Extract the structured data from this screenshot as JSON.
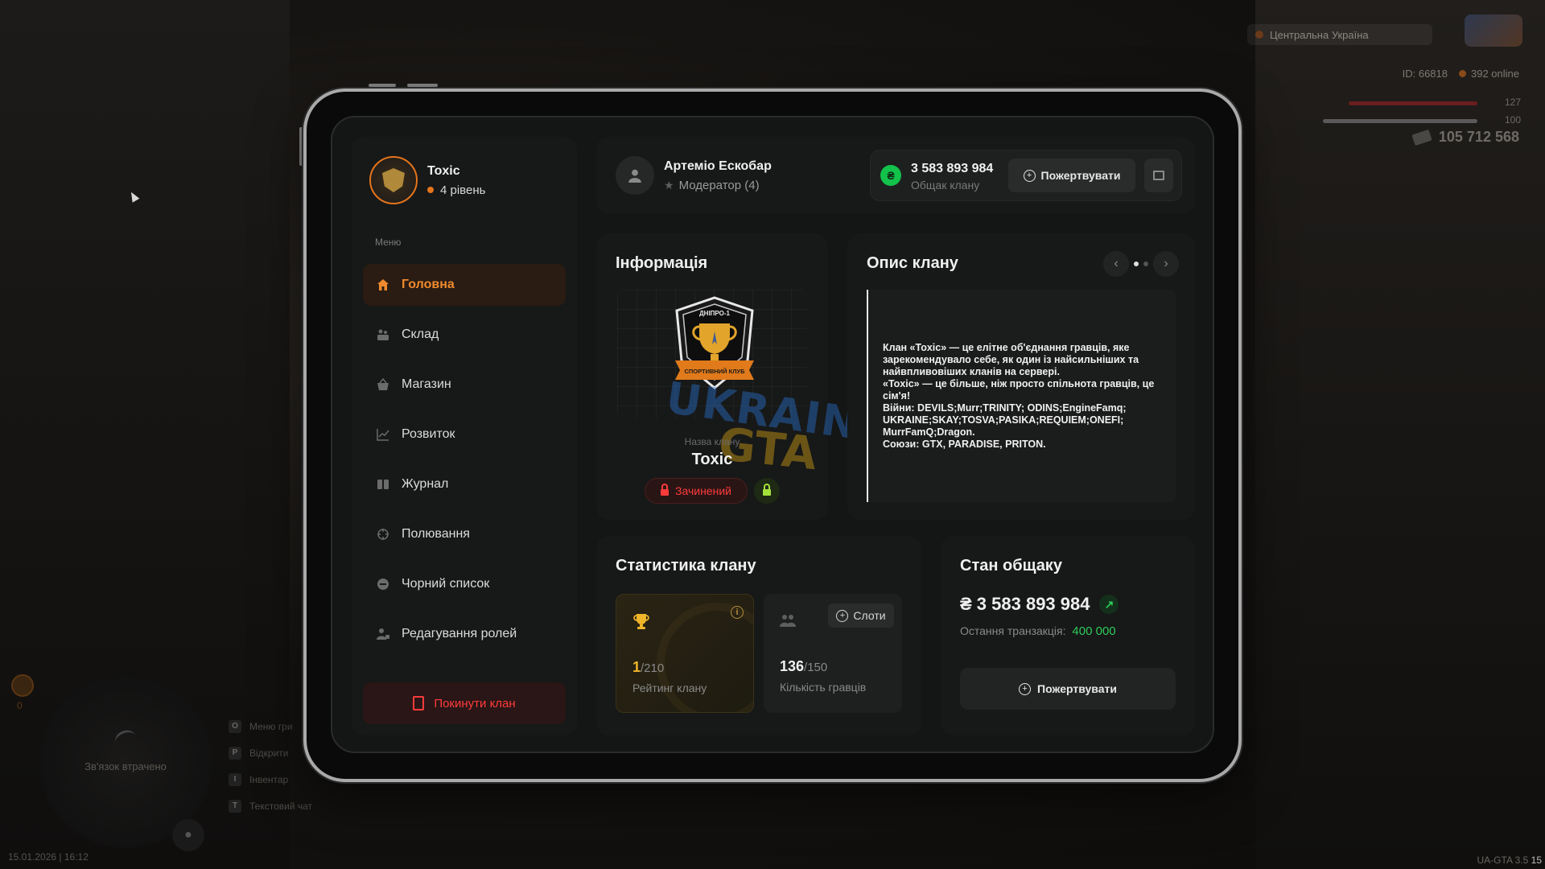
{
  "hud": {
    "region": "Центральна Україна",
    "player_id": "ID: 66818",
    "online": "392 online",
    "health": "127",
    "armor": "100",
    "money": "105 712 568",
    "minimap_status": "Зв'язок втрачено",
    "orange_counter": "0",
    "hints": [
      {
        "key": "O",
        "label": "Меню гри"
      },
      {
        "key": "P",
        "label": "Відкрити"
      },
      {
        "key": "I",
        "label": "Інвентар"
      },
      {
        "key": "T",
        "label": "Текстовий чат"
      }
    ],
    "datetime": "15.01.2026 | 16:12",
    "version": "UA-GTA 3.5",
    "version_suffix": "15"
  },
  "profile": {
    "clan_name": "Toxic",
    "level": "4 рівень"
  },
  "menu": {
    "caption": "Меню",
    "items": [
      {
        "label": "Головна",
        "icon": "home-icon",
        "active": true
      },
      {
        "label": "Склад",
        "icon": "warehouse-icon"
      },
      {
        "label": "Магазин",
        "icon": "basket-icon"
      },
      {
        "label": "Розвиток",
        "icon": "chart-icon"
      },
      {
        "label": "Журнал",
        "icon": "book-icon"
      },
      {
        "label": "Полювання",
        "icon": "crosshair-icon"
      },
      {
        "label": "Чорний список",
        "icon": "blocked-icon"
      },
      {
        "label": "Редагування ролей",
        "icon": "user-edit-icon"
      }
    ],
    "leave_label": "Покинути клан"
  },
  "user": {
    "name": "Артеміо Ескобар",
    "role": "Модератор (4)"
  },
  "wallet": {
    "currency_symbol": "₴",
    "amount": "3 583 893 984",
    "label": "Общак клану",
    "donate_label": "Пожертвувати"
  },
  "info": {
    "title": "Інформація",
    "emblem_top_text": "ДНІПРО-1",
    "emblem_ribbon_text": "СПОРТИВНИЙ КЛУБ",
    "watermark_line1": "UKRAINA",
    "watermark_line2": "GTA",
    "clan_name_caption": "Назва клану",
    "clan_name": "Toxic",
    "closed_label": "Зачинений"
  },
  "description": {
    "title": "Опис клану",
    "text": "Клан «Toxic» — це елітне об'єднання гравців, яке зарекомендувало себе, як один із найсильніших та найвпливовіших кланів на сервері.\n«Toxic» — це більше, ніж просто спільнота гравців, це сім'я!\nВійни: DEVILS;Murr;TRINITY; ODINS;EngineFamq; UKRAINE;SKAY;TOSVA;PASIKA;REQUIEM;ONEFI; MurrFamQ;Dragon.\nСоюзи: GTX, PARADISE, PRITON."
  },
  "stats": {
    "title": "Статистика клану",
    "rating_value": "1",
    "rating_total": "/210",
    "rating_label": "Рейтинг клану",
    "players_value": "136",
    "players_total": "/150",
    "players_label": "Кількість гравців",
    "slots_label": "Слоти"
  },
  "bank": {
    "title": "Стан общаку",
    "amount": "₴ 3 583 893 984",
    "last_tx_label": "Остання транзакція:",
    "last_tx_value": "400 000",
    "donate_label": "Пожертвувати"
  },
  "colors": {
    "accent": "#f08a2e",
    "danger": "#ff3b3b",
    "success": "#2ecc5a",
    "gold": "#f0b62a"
  }
}
